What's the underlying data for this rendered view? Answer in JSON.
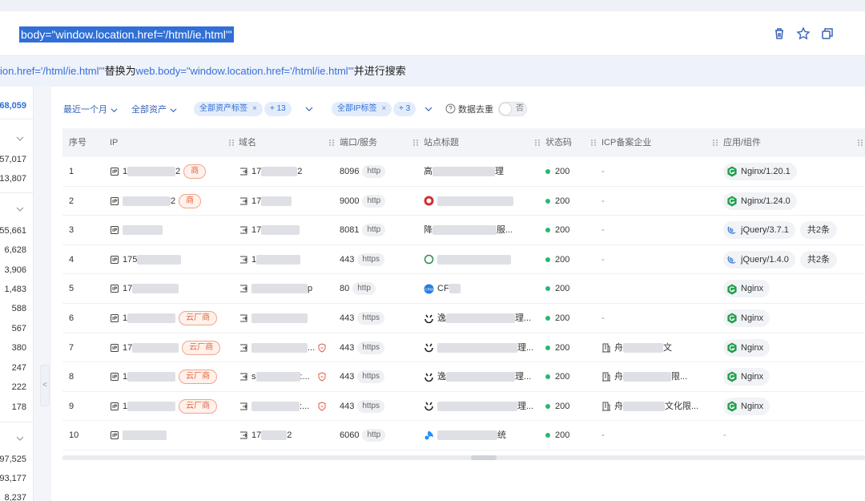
{
  "search": {
    "query": "body=\"window.location.href='/html/ie.html'\"",
    "hint_prefix": "ion.href='/html/ie.html'\"",
    "hint_mid": "替换为",
    "hint_suggest": "web.body=\"window.location.href='/html/ie.html'\"",
    "hint_suffix": "并进行搜索"
  },
  "sidebar": {
    "counts": [
      "68,059",
      "57,017",
      "413,807",
      "455,661",
      "6,628",
      "3,906",
      "1,483",
      "588",
      "567",
      "380",
      "247",
      "222",
      "178",
      "97,525",
      "93,177",
      "8,237"
    ],
    "collapse": "<"
  },
  "filters": {
    "time": "最近一个月",
    "assets": "全部资产",
    "asset_tag": "全部资产标签",
    "asset_tag_more": "+ 13",
    "ip_tag": "全部IP标签",
    "ip_tag_more": "+ 3",
    "dedupe_label": "数据去重",
    "dedupe_value": "否"
  },
  "table": {
    "headers": [
      "序号",
      "IP",
      "域名",
      "端口/服务",
      "站点标题",
      "状态码",
      "ICP备案企业",
      "应用/组件"
    ],
    "rows": [
      {
        "idx": "1",
        "ip_a": "1",
        "ip_b": "2",
        "cloud": "商",
        "dom": "17",
        "dom_b": "2",
        "port": "8096",
        "svc": "http",
        "title_a": "高",
        "title_b": "理",
        "status": "200",
        "icp": "-",
        "comp": "Nginx/1.20.1",
        "comp_type": "nginx",
        "extra": ""
      },
      {
        "idx": "2",
        "ip_a": "",
        "ip_b": "2",
        "cloud": "商",
        "dom": "17",
        "dom_b": "",
        "port": "9000",
        "svc": "http",
        "title_a": "",
        "title_b": "",
        "status": "200",
        "icp": "-",
        "comp": "Nginx/1.24.0",
        "comp_type": "nginx",
        "extra": ""
      },
      {
        "idx": "3",
        "ip_a": "",
        "ip_b": "",
        "cloud": "",
        "dom": "17",
        "dom_b": "",
        "port": "8081",
        "svc": "http",
        "title_a": "降",
        "title_b": "服...",
        "status": "200",
        "icp": "-",
        "comp": "jQuery/3.7.1",
        "comp_type": "jquery",
        "extra": "共2条"
      },
      {
        "idx": "4",
        "ip_a": "175",
        "ip_b": "",
        "cloud": "",
        "dom": "1",
        "dom_b": "",
        "port": "443",
        "svc": "https",
        "title_a": "",
        "title_b": "",
        "status": "200",
        "icp": "-",
        "comp": "jQuery/1.4.0",
        "comp_type": "jquery",
        "extra": "共2条"
      },
      {
        "idx": "5",
        "ip_a": "17",
        "ip_b": "",
        "cloud": "",
        "dom": "",
        "dom_b": "p",
        "port": "80",
        "svc": "http",
        "title_a": "CF",
        "title_b": "",
        "status": "200",
        "icp": "",
        "comp": "Nginx",
        "comp_type": "nginx",
        "extra": ""
      },
      {
        "idx": "6",
        "ip_a": "1",
        "ip_b": "",
        "cloud": "云厂商",
        "dom": "",
        "dom_b": "",
        "port": "443",
        "svc": "https",
        "title_a": "逸",
        "title_b": "理...",
        "status": "200",
        "icp": "-",
        "comp": "Nginx",
        "comp_type": "nginx",
        "extra": ""
      },
      {
        "idx": "7",
        "ip_a": "17",
        "ip_b": "",
        "cloud": "云厂商",
        "dom": "",
        "dom_b": "...",
        "port": "443",
        "svc": "https",
        "title_a": "",
        "title_b": "理...",
        "status": "200",
        "icp": "舟",
        "icp_b": "文",
        "comp": "Nginx",
        "comp_type": "nginx",
        "extra": ""
      },
      {
        "idx": "8",
        "ip_a": "1",
        "ip_b": "",
        "cloud": "云厂商",
        "dom": "s",
        "dom_b": ":...",
        "port": "443",
        "svc": "https",
        "title_a": "逸",
        "title_b": "理...",
        "status": "200",
        "icp": "舟",
        "icp_b": "限...",
        "comp": "Nginx",
        "comp_type": "nginx",
        "extra": ""
      },
      {
        "idx": "9",
        "ip_a": "1",
        "ip_b": "",
        "cloud": "云厂商",
        "dom": "",
        "dom_b": ":...",
        "port": "443",
        "svc": "https",
        "title_a": "",
        "title_b": "理...",
        "status": "200",
        "icp": "舟",
        "icp_b": "文化限...",
        "comp": "Nginx",
        "comp_type": "nginx",
        "extra": ""
      },
      {
        "idx": "10",
        "ip_a": "",
        "ip_b": "",
        "cloud": "",
        "dom": "17",
        "dom_b": "2",
        "port": "6060",
        "svc": "http",
        "title_a": "",
        "title_b": "统",
        "status": "200",
        "icp": "-",
        "comp": "-",
        "comp_type": "none",
        "extra": ""
      }
    ]
  },
  "colors": {
    "accent": "#2f6fd6",
    "status_ok": "#2bb673",
    "cloud_tag": "#e0683f",
    "nginx": "#1f9e4a"
  }
}
